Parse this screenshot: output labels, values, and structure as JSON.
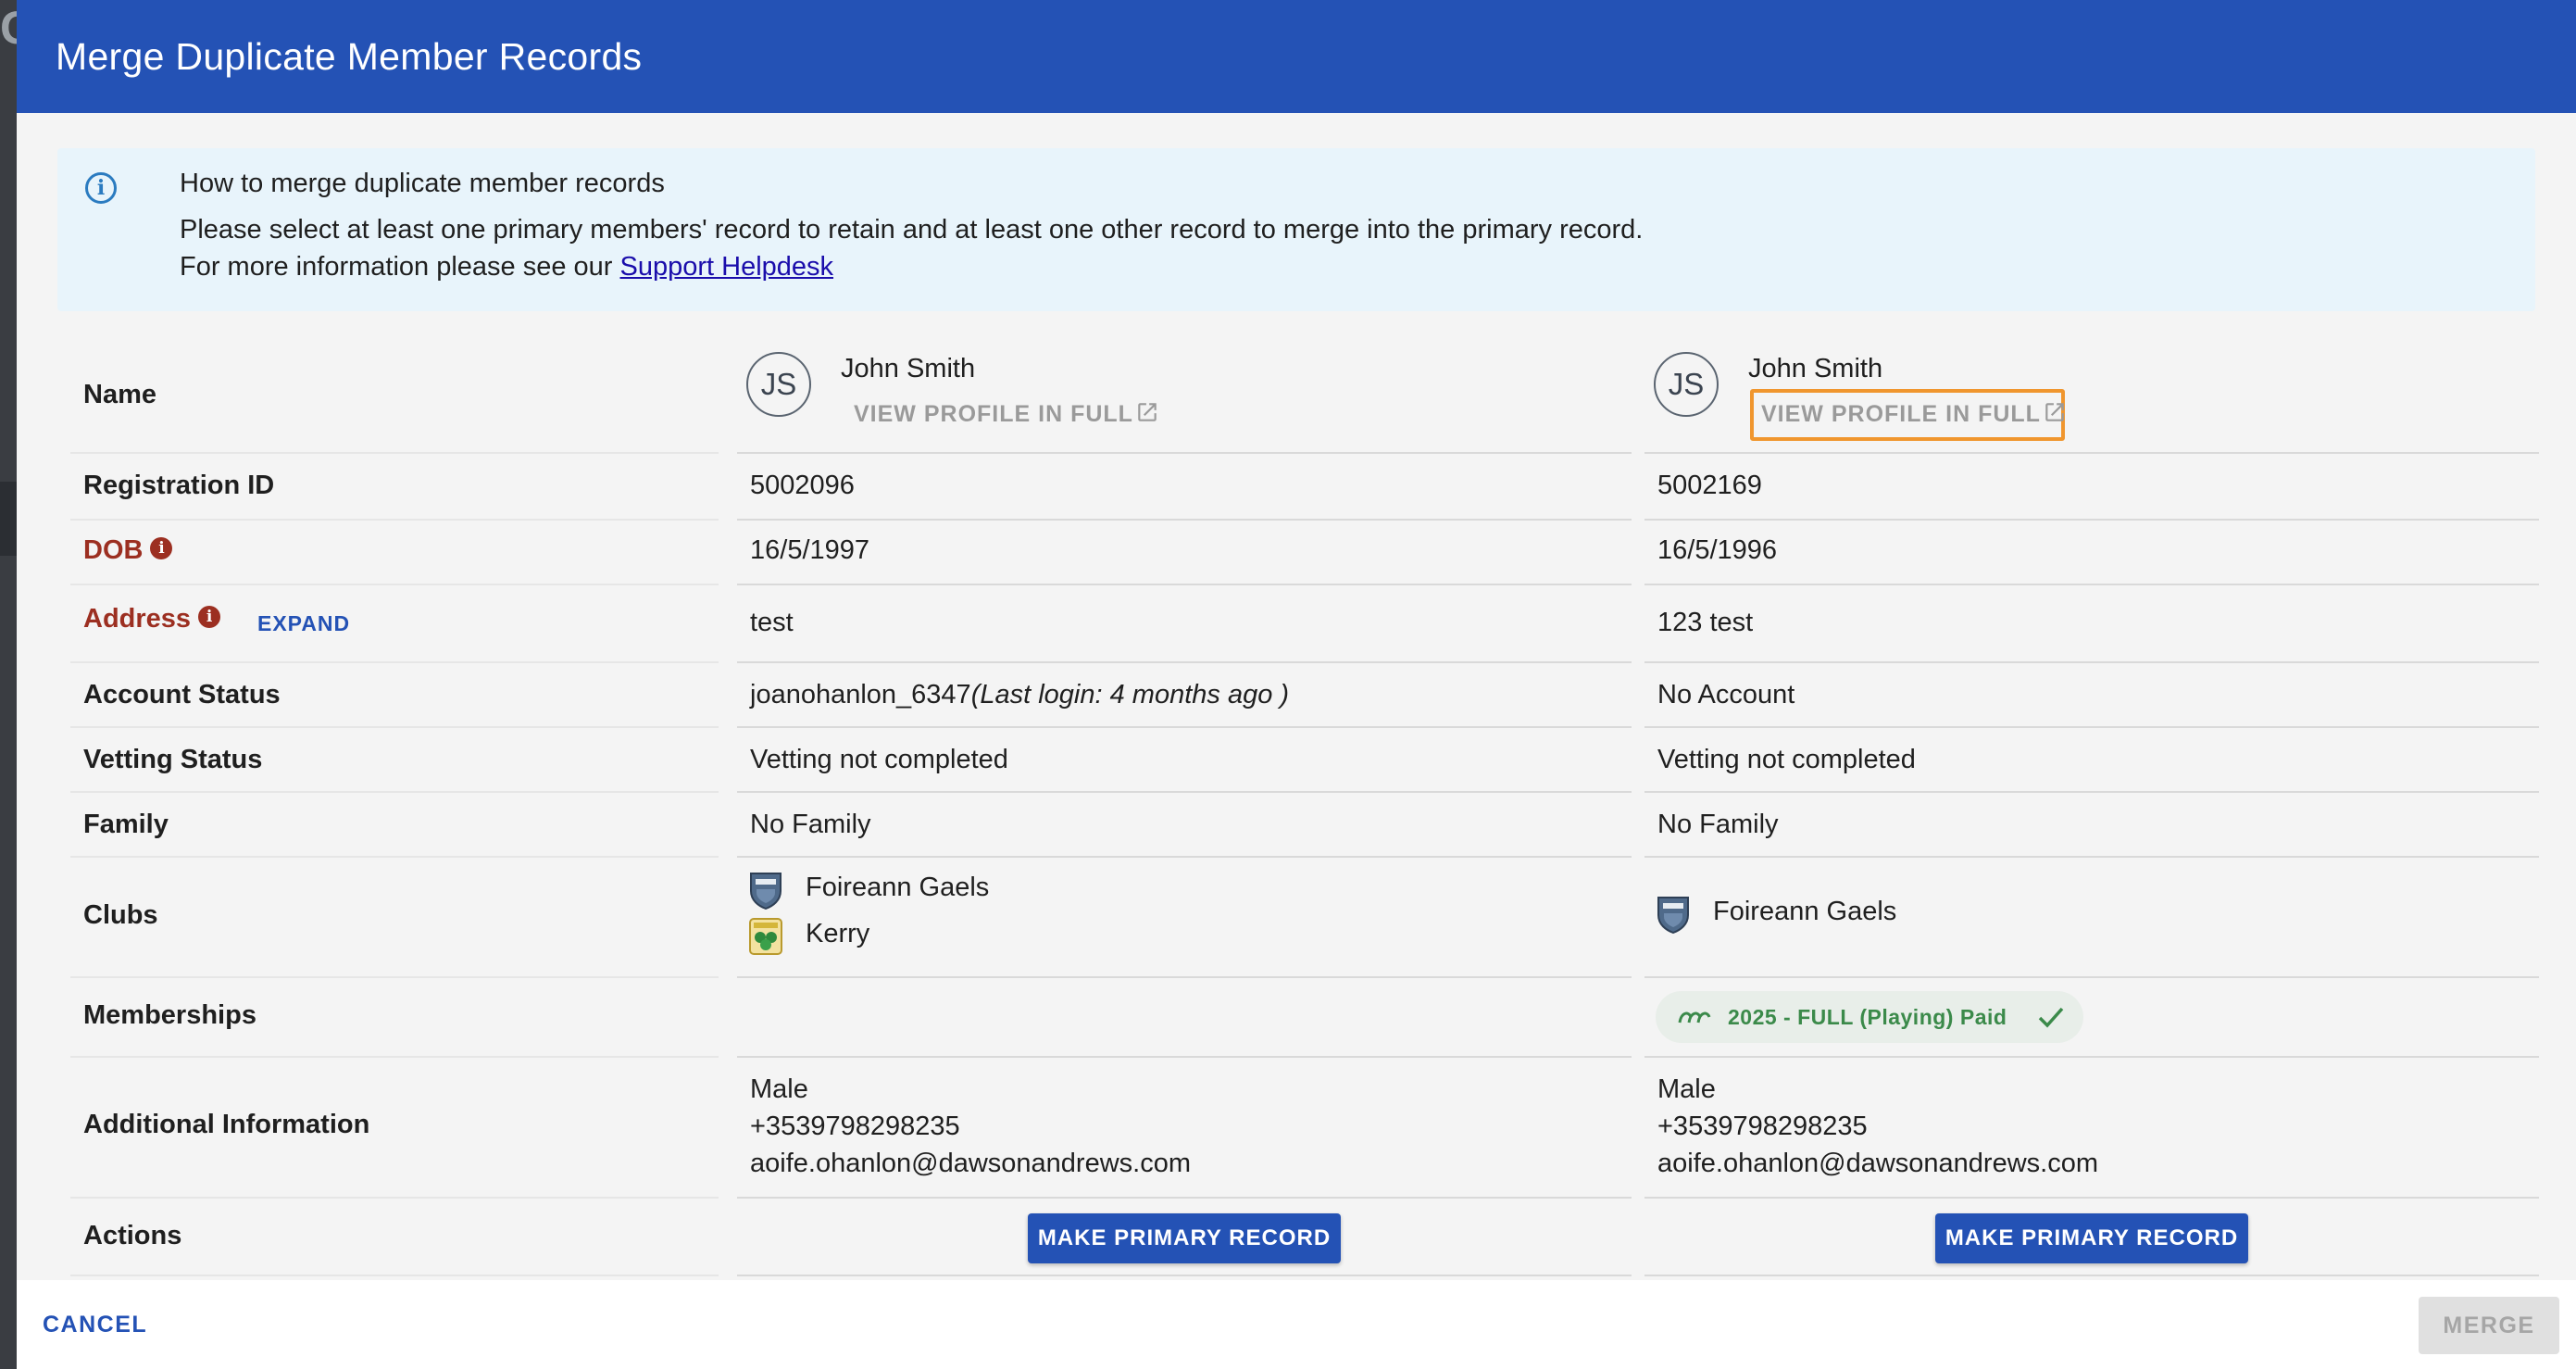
{
  "dialog": {
    "title": "Merge Duplicate Member Records"
  },
  "info": {
    "heading": "How to merge duplicate member records",
    "line1": "Please select at least one primary members' record to retain and at least one other record to merge into the primary record.",
    "line2_prefix": "For more information please see our ",
    "link_text": "Support Helpdesk"
  },
  "rows": {
    "name": "Name",
    "registration_id": "Registration ID",
    "dob": "DOB",
    "address": "Address",
    "address_expand": "EXPAND",
    "account_status": "Account Status",
    "vetting_status": "Vetting Status",
    "family": "Family",
    "clubs": "Clubs",
    "memberships": "Memberships",
    "additional_information": "Additional Information",
    "actions": "Actions"
  },
  "records": [
    {
      "initials": "JS",
      "name": "John Smith",
      "view_profile": "VIEW PROFILE IN FULL",
      "registration_id": "5002096",
      "dob": "16/5/1997",
      "address": "test",
      "account_username": "joanohanlon_6347",
      "account_login": "(Last login: 4 months ago )",
      "vetting_status": "Vetting not completed",
      "family": "No Family",
      "clubs": [
        "Foireann Gaels",
        "Kerry"
      ],
      "membership": "",
      "gender": "Male",
      "phone": "+3539798298235",
      "email": "aoife.ohanlon@dawsonandrews.com",
      "action": "MAKE PRIMARY RECORD"
    },
    {
      "initials": "JS",
      "name": "John Smith",
      "view_profile": "VIEW PROFILE IN FULL",
      "registration_id": "5002169",
      "dob": "16/5/1996",
      "address": "123 test",
      "account_status": "No Account",
      "vetting_status": "Vetting not completed",
      "family": "No Family",
      "clubs": [
        "Foireann Gaels"
      ],
      "membership": "2025 - FULL (Playing) Paid",
      "gender": "Male",
      "phone": "+3539798298235",
      "email": "aoife.ohanlon@dawsonandrews.com",
      "action": "MAKE PRIMARY RECORD"
    }
  ],
  "footer": {
    "cancel": "CANCEL",
    "merge": "MERGE"
  },
  "colors": {
    "primary": "#2452b5",
    "warning_label": "#9c2f21",
    "membership_green": "#3b8a4a",
    "highlight": "#f0962e"
  },
  "icons": {
    "info": "info-circle-icon",
    "external": "external-link-icon",
    "check": "check-icon"
  }
}
